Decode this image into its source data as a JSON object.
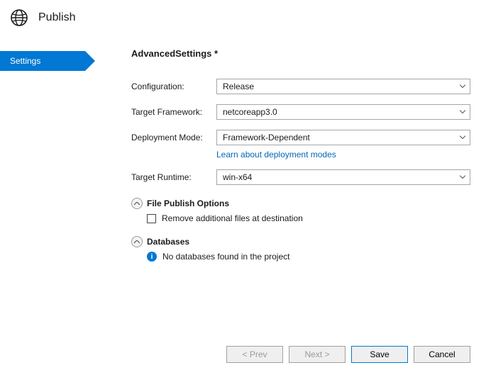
{
  "header": {
    "title": "Publish"
  },
  "sidebar": {
    "items": [
      {
        "label": "Settings"
      }
    ]
  },
  "main": {
    "title": "AdvancedSettings *",
    "fields": {
      "configuration": {
        "label": "Configuration:",
        "value": "Release"
      },
      "targetFramework": {
        "label": "Target Framework:",
        "value": "netcoreapp3.0"
      },
      "deploymentMode": {
        "label": "Deployment Mode:",
        "value": "Framework-Dependent",
        "link": "Learn about deployment modes"
      },
      "targetRuntime": {
        "label": "Target Runtime:",
        "value": "win-x64"
      }
    },
    "sections": {
      "filePublish": {
        "title": "File Publish Options",
        "checkboxLabel": "Remove additional files at destination"
      },
      "databases": {
        "title": "Databases",
        "message": "No databases found in the project"
      }
    }
  },
  "footer": {
    "prev": "< Prev",
    "next": "Next >",
    "save": "Save",
    "cancel": "Cancel"
  }
}
